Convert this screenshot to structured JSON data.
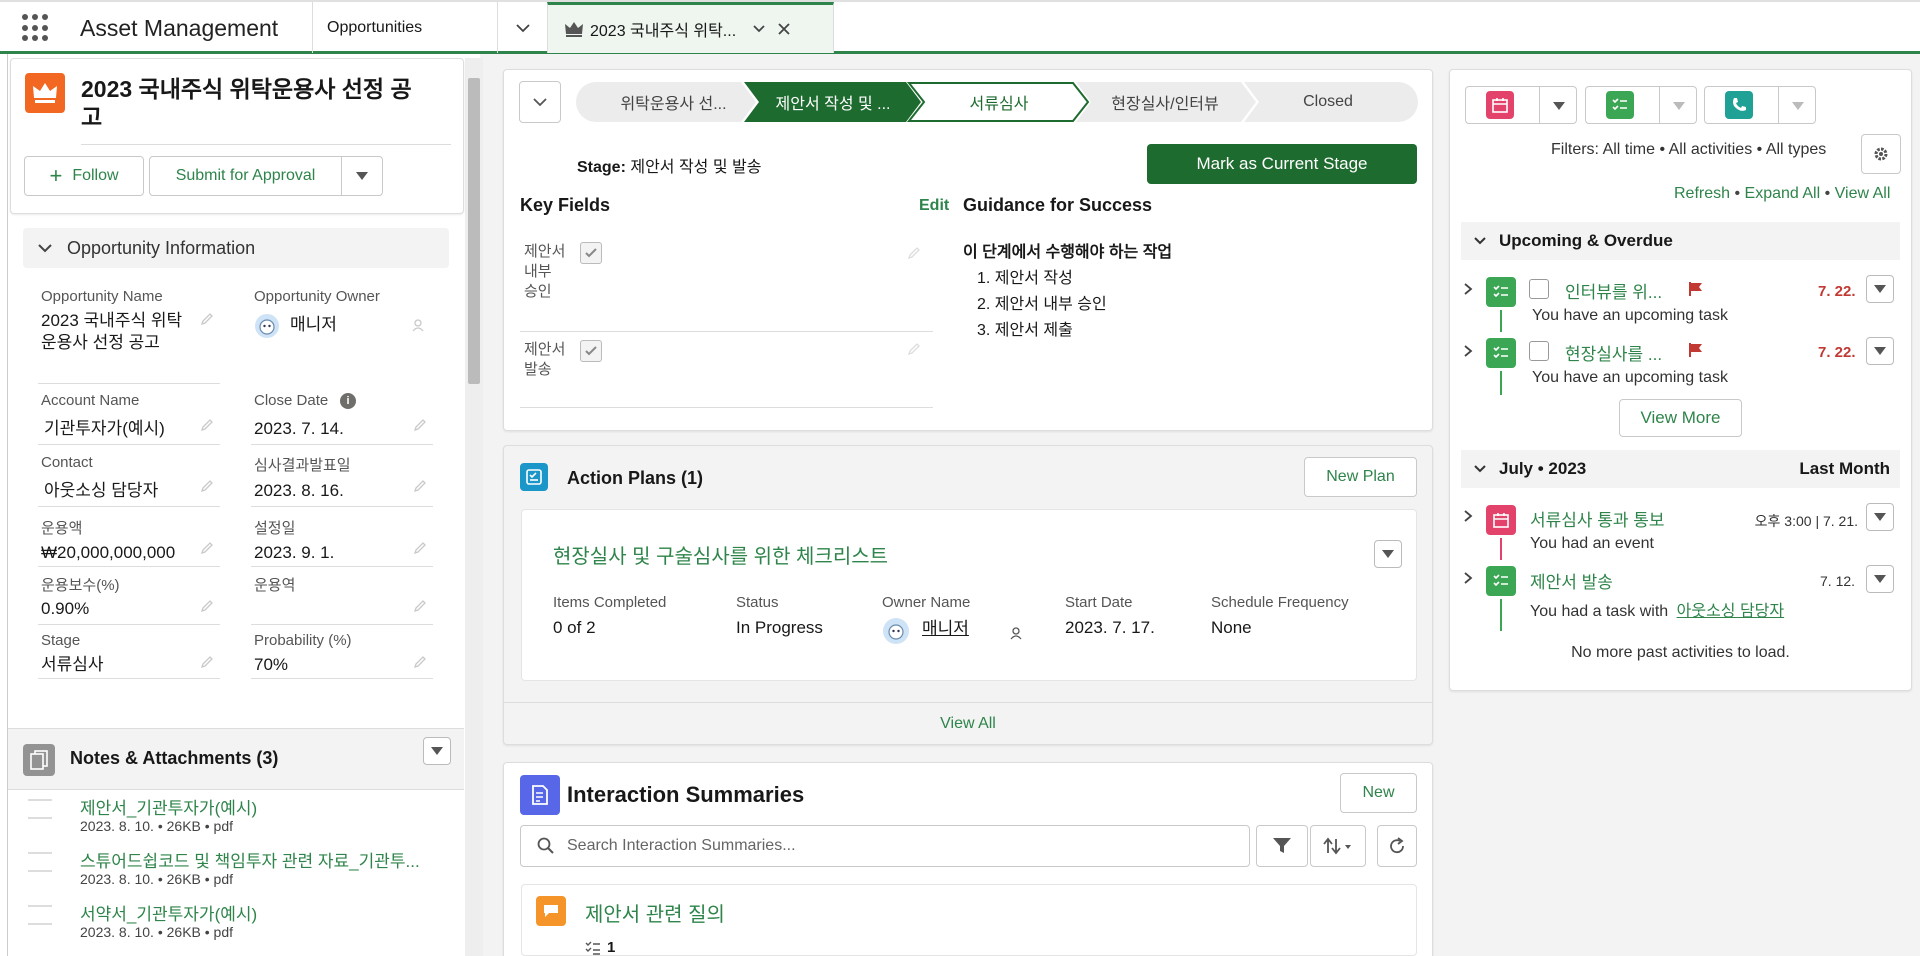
{
  "nav": {
    "app_name": "Asset Management",
    "object_tab": "Opportunities",
    "record_tab": "2023 국내주식 위탁..."
  },
  "record": {
    "title": "2023 국내주식 위탁운용사 선정 공고",
    "follow_label": "Follow",
    "submit_label": "Submit for Approval"
  },
  "opp_info": {
    "section_title": "Opportunity Information",
    "fields": {
      "opp_name_label": "Opportunity Name",
      "opp_name_value": "2023 국내주식 위탁운용사 선정 공고",
      "owner_label": "Opportunity Owner",
      "owner_value": "매니저",
      "account_label": "Account Name",
      "account_value": "기관투자가(예시)",
      "close_label": "Close Date",
      "close_value": "2023. 7. 14.",
      "contact_label": "Contact",
      "contact_value": "아웃소싱 담당자",
      "review_label": "심사결과발표일",
      "review_value": "2023. 8. 16.",
      "amount_label": "운용액",
      "amount_value": "₩20,000,000,000",
      "setup_label": "설정일",
      "setup_value": "2023. 9. 1.",
      "fee_label": "운용보수(%)",
      "fee_value": "0.90%",
      "role_label": "운용역",
      "role_value": "",
      "stage_label": "Stage",
      "stage_value": "서류심사",
      "prob_label": "Probability (%)",
      "prob_value": "70%"
    }
  },
  "notes": {
    "title": "Notes & Attachments (3)",
    "items": [
      {
        "name": "제안서_기관투자가(예시)",
        "meta": "2023. 8. 10. • 26KB • pdf"
      },
      {
        "name": "스튜어드쉽코드 및 책임투자 관련 자료_기관투...",
        "meta": "2023. 8. 10. • 26KB • pdf"
      },
      {
        "name": "서약서_기관투자가(예시)",
        "meta": "2023. 8. 10. • 26KB • pdf"
      }
    ]
  },
  "path": {
    "steps": [
      "위탁운용사 선...",
      "제안서 작성 및 ...",
      "서류심사",
      "현장실사/인터뷰",
      "Closed"
    ],
    "stage_label": "Stage:",
    "stage_value": "제안서 작성 및 발송",
    "mark_button": "Mark as Current Stage",
    "key_fields_title": "Key Fields",
    "edit_label": "Edit",
    "key_fields": [
      "제안서 내부 승인",
      "제안서 발송"
    ],
    "guidance_title": "Guidance for Success",
    "guidance_heading": "이 단계에서 수행해야 하는 작업",
    "guidance_items": [
      "1. 제안서 작성",
      "2. 제안서 내부 승인",
      "3. 제안서 제출"
    ]
  },
  "action_plans": {
    "title": "Action Plans (1)",
    "new_button": "New Plan",
    "plan_name": "현장실사 및 구술심사를 위한 체크리스트",
    "cols": {
      "items_label": "Items Completed",
      "items_value": "0 of 2",
      "status_label": "Status",
      "status_value": "In Progress",
      "owner_label": "Owner Name",
      "owner_value": "매니저",
      "start_label": "Start Date",
      "start_value": "2023. 7. 17.",
      "freq_label": "Schedule Frequency",
      "freq_value": "None"
    },
    "view_all": "View All"
  },
  "interactions": {
    "title": "Interaction Summaries",
    "new_button": "New",
    "search_placeholder": "Search Interaction Summaries...",
    "item_title": "제안서 관련 질의",
    "item_count": "1"
  },
  "activity": {
    "filters": "Filters: All time • All activities • All types",
    "refresh": "Refresh",
    "expand_all": "Expand All",
    "view_all": "View All",
    "upcoming_title": "Upcoming & Overdue",
    "upcoming": [
      {
        "title": "인터뷰를 위...",
        "sub": "You have an upcoming task",
        "date": "7. 22."
      },
      {
        "title": "현장실사를 ...",
        "sub": "You have an upcoming task",
        "date": "7. 22."
      }
    ],
    "view_more": "View More",
    "month_title": "July • 2023",
    "month_right": "Last Month",
    "past": [
      {
        "title": "서류심사 통과 통보",
        "sub": "You had an event",
        "date": "오후 3:00 | 7. 21."
      },
      {
        "title": "제안서 발송",
        "sub": "You had a task with",
        "sub_link": "아웃소싱 담당자",
        "date": "7. 12."
      }
    ],
    "no_more": "No more past activities to load."
  },
  "colors": {
    "brand": "#2e844a",
    "stage_dark": "#1e6b2f",
    "overdue": "#c23934",
    "record_icon": "#f26722",
    "event_icon": "#e3426b",
    "task_icon": "#3ba755",
    "call_icon": "#1fa196",
    "action_icon": "#1b96c9",
    "interaction_icon": "#5867e8"
  }
}
